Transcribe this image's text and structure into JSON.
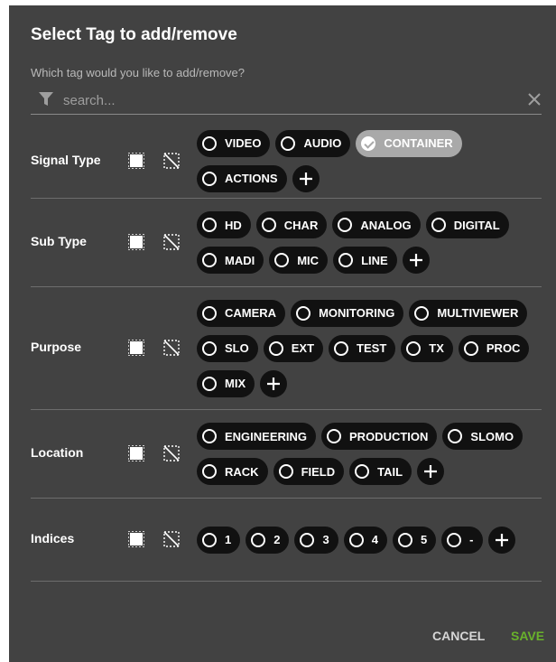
{
  "dialog": {
    "title": "Select Tag to add/remove",
    "subtitle": "Which tag would you like to add/remove?",
    "search_placeholder": "search...",
    "cancel_label": "CANCEL",
    "save_label": "SAVE"
  },
  "sections": [
    {
      "label": "Signal Type",
      "tags": [
        {
          "label": "VIDEO",
          "selected": false
        },
        {
          "label": "AUDIO",
          "selected": false
        },
        {
          "label": "CONTAINER",
          "selected": true
        },
        {
          "label": "ACTIONS",
          "selected": false
        }
      ]
    },
    {
      "label": "Sub Type",
      "tags": [
        {
          "label": "HD",
          "selected": false
        },
        {
          "label": "CHAR",
          "selected": false
        },
        {
          "label": "ANALOG",
          "selected": false
        },
        {
          "label": "DIGITAL",
          "selected": false
        },
        {
          "label": "MADI",
          "selected": false
        },
        {
          "label": "MIC",
          "selected": false
        },
        {
          "label": "LINE",
          "selected": false
        }
      ]
    },
    {
      "label": "Purpose",
      "tags": [
        {
          "label": "CAMERA",
          "selected": false
        },
        {
          "label": "MONITORING",
          "selected": false
        },
        {
          "label": "MULTIVIEWER",
          "selected": false
        },
        {
          "label": "SLO",
          "selected": false
        },
        {
          "label": "EXT",
          "selected": false
        },
        {
          "label": "TEST",
          "selected": false
        },
        {
          "label": "TX",
          "selected": false
        },
        {
          "label": "PROC",
          "selected": false
        },
        {
          "label": "MIX",
          "selected": false
        }
      ]
    },
    {
      "label": "Location",
      "tags": [
        {
          "label": "ENGINEERING",
          "selected": false
        },
        {
          "label": "PRODUCTION",
          "selected": false
        },
        {
          "label": "SLOMO",
          "selected": false
        },
        {
          "label": "RACK",
          "selected": false
        },
        {
          "label": "FIELD",
          "selected": false
        },
        {
          "label": "TAIL",
          "selected": false
        }
      ]
    },
    {
      "label": "Indices",
      "tags": [
        {
          "label": "1",
          "selected": false
        },
        {
          "label": "2",
          "selected": false
        },
        {
          "label": "3",
          "selected": false
        },
        {
          "label": "4",
          "selected": false
        },
        {
          "label": "5",
          "selected": false
        },
        {
          "label": "-",
          "selected": false
        }
      ]
    }
  ],
  "icons": {
    "filter": "filter-icon",
    "clear": "close-icon",
    "select_all": "select-all-icon",
    "deselect_all": "deselect-all-icon",
    "add": "plus-icon"
  },
  "colors": {
    "dialog_bg": "#424242",
    "chip_bg": "#111111",
    "chip_selected_bg": "#a9a9a9",
    "save": "#69b22b"
  }
}
